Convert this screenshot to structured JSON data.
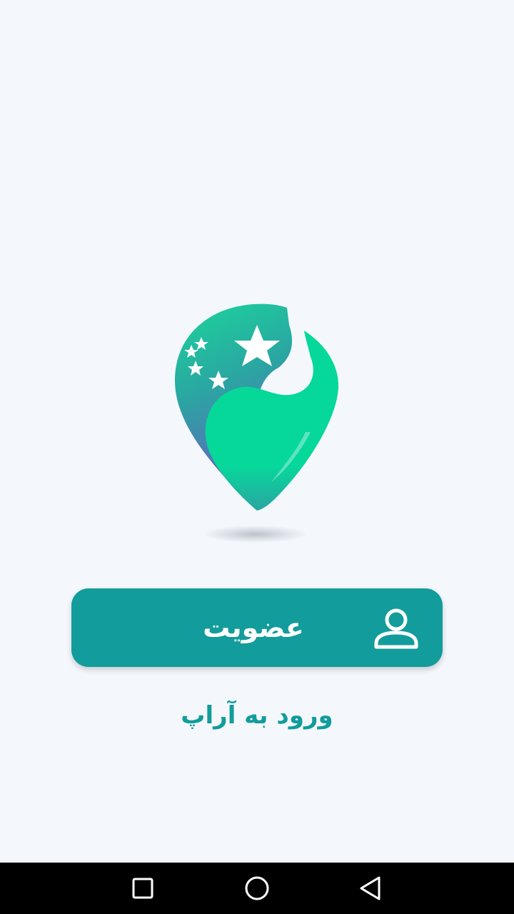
{
  "app": {
    "logo_icon": "map-pin-star-logo",
    "accent_color": "#129c9c",
    "logo_green": "#06d89a",
    "logo_purple": "#6a5bc2",
    "background_color": "#f4f8fc"
  },
  "signup": {
    "label": "عضویت",
    "icon": "user-icon"
  },
  "login": {
    "label": "ورود به آراپ"
  },
  "navigation_bar": {
    "buttons": [
      "recents-square-icon",
      "home-circle-icon",
      "back-triangle-icon"
    ]
  }
}
